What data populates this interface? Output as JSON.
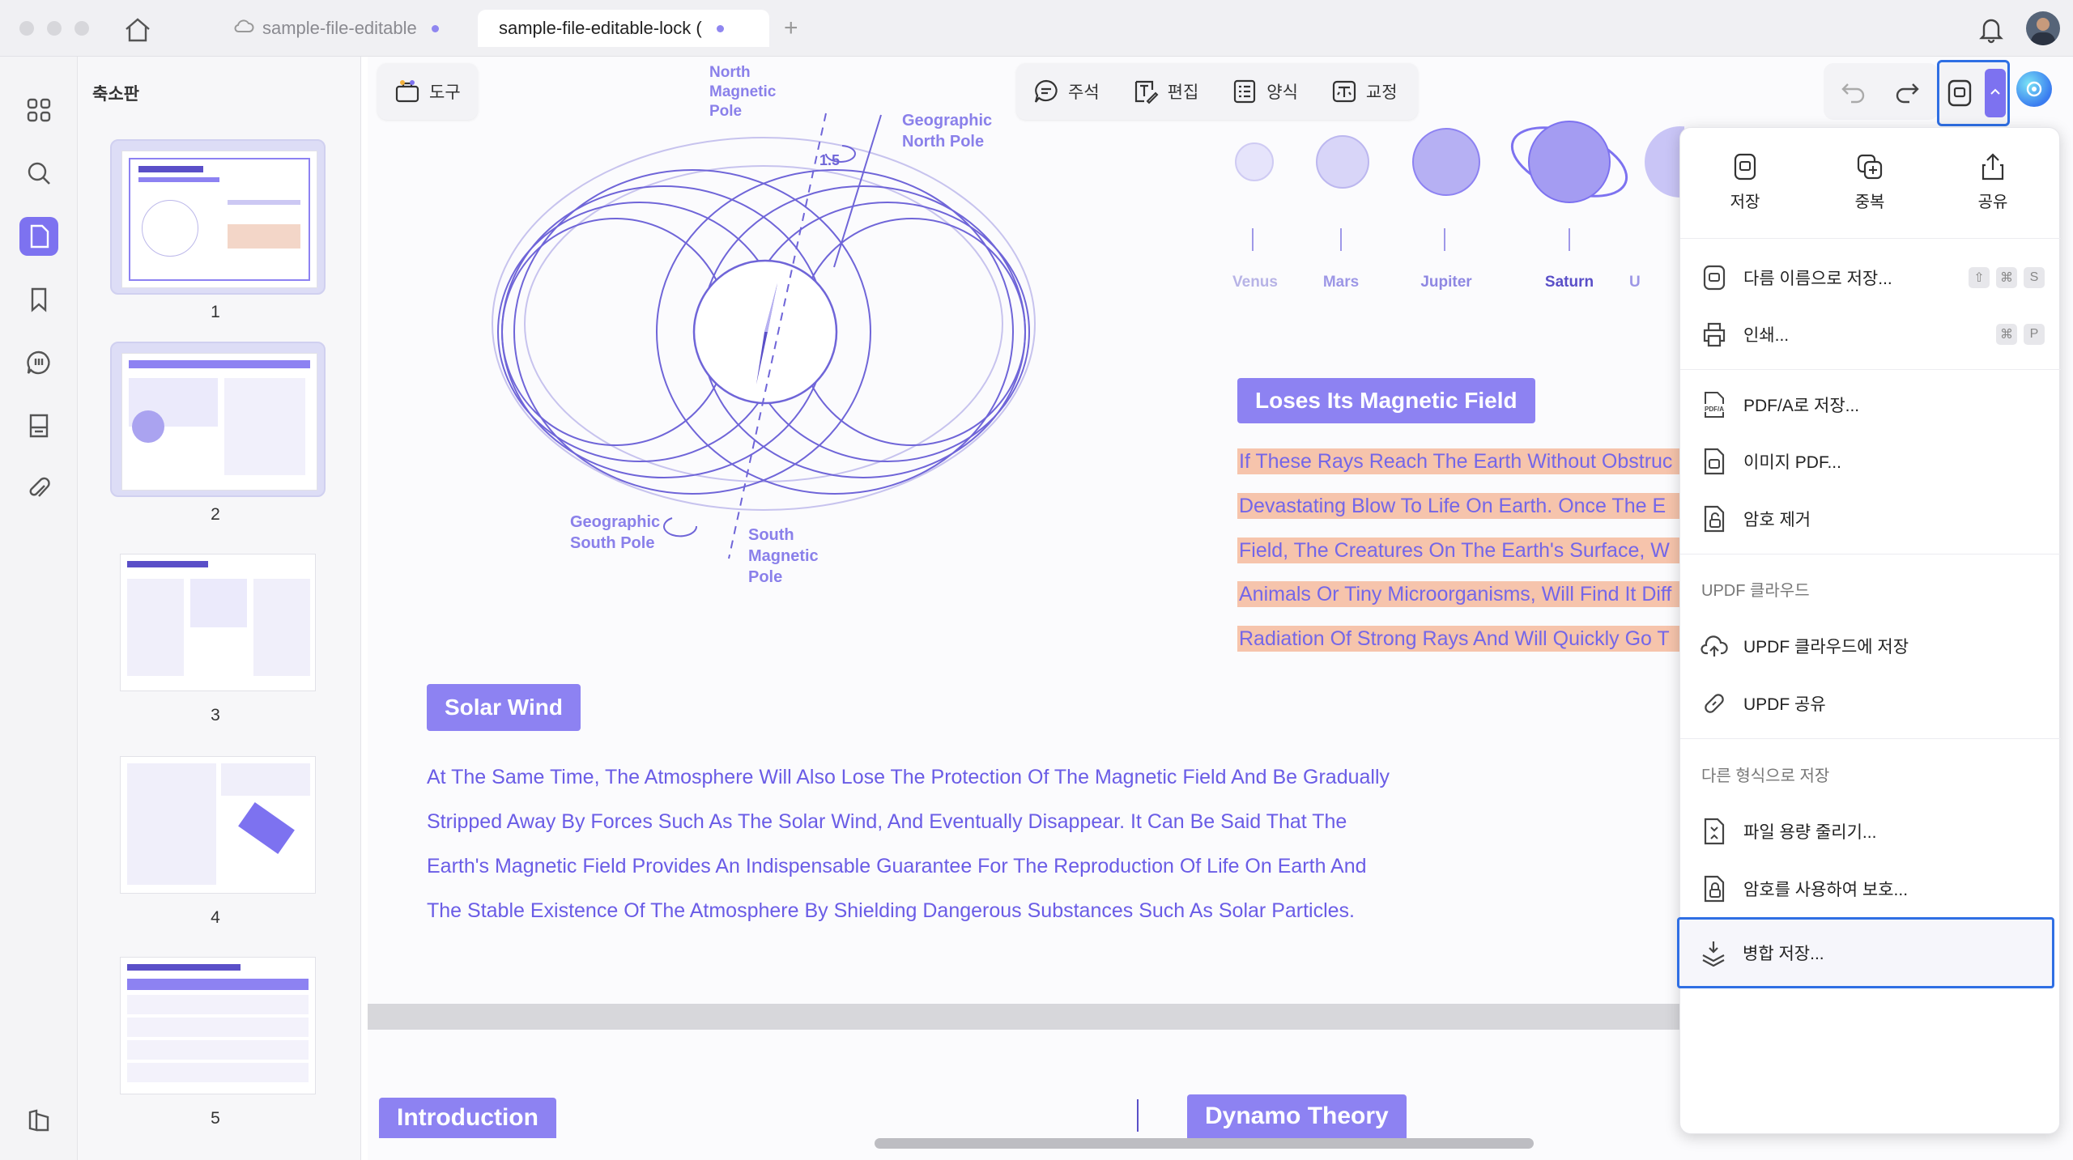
{
  "tabs": [
    {
      "label": "sample-file-editable"
    },
    {
      "label": "sample-file-editable-lock ("
    }
  ],
  "sidebar": {
    "panel_title": "축소판",
    "page_numbers": [
      "1",
      "2",
      "3",
      "4",
      "5"
    ]
  },
  "toolbar": {
    "tool_label": "도구",
    "comment_label": "주석",
    "edit_label": "편집",
    "form_label": "양식",
    "proofread_label": "교정"
  },
  "document": {
    "diagram": {
      "north_magnetic_pole": "North Magnetic Pole",
      "geographic_north_pole": "Geographic North Pole",
      "tilt_value": "1.5",
      "geographic_south_pole": "Geographic South Pole",
      "south_magnetic_pole": "South Magnetic Pole"
    },
    "planets": [
      "Venus",
      "Mars",
      "Jupiter",
      "Saturn",
      "U"
    ],
    "heading_magnetic": "Loses Its Magnetic Field",
    "highlighted_lines": [
      "If These Rays Reach The Earth Without Obstruc",
      "Devastating Blow To Life On Earth. Once The E",
      "Field, The Creatures On The Earth's Surface, W",
      "Animals Or Tiny Microorganisms, Will Find It Diff",
      "Radiation Of Strong Rays And Will Quickly Go T"
    ],
    "heading_solar": "Solar Wind",
    "solar_paragraph": [
      "At The Same Time, The Atmosphere Will Also Lose The Protection Of The Magnetic Field And Be Gradually",
      "Stripped Away By Forces Such As The Solar Wind, And Eventually Disappear. It Can Be Said That The",
      "Earth's Magnetic Field Provides An Indispensable Guarantee For The Reproduction Of Life On Earth And",
      "The Stable Existence Of The Atmosphere By Shielding Dangerous Substances Such As Solar Particles."
    ],
    "next_page_heading_left": "Introduction",
    "next_page_heading_right": "Dynamo Theory"
  },
  "save_menu": {
    "top_actions": [
      {
        "label": "저장",
        "icon": "save-icon"
      },
      {
        "label": "중복",
        "icon": "duplicate-icon"
      },
      {
        "label": "공유",
        "icon": "share-icon"
      }
    ],
    "save_as": "다름 이름으로 저장...",
    "save_as_keys": [
      "⇧",
      "⌘",
      "S"
    ],
    "print": "인쇄...",
    "print_keys": [
      "⌘",
      "P"
    ],
    "pdfa": "PDF/A로 저장...",
    "image_pdf": "이미지 PDF...",
    "remove_password": "암호 제거",
    "cloud_section": "UPDF 클라우드",
    "save_to_cloud": "UPDF 클라우드에 저장",
    "updf_share": "UPDF 공유",
    "other_section": "다른 형식으로 저장",
    "reduce_size": "파일 용량 줄리기...",
    "protect_password": "암호를 사용하여 보호...",
    "flatten_save": "병합 저장..."
  },
  "colors": {
    "accent": "#7d72f0",
    "highlight": "#f6c4ac",
    "doc_text": "#6a5ce6",
    "focus_border": "#2f6fe4"
  }
}
